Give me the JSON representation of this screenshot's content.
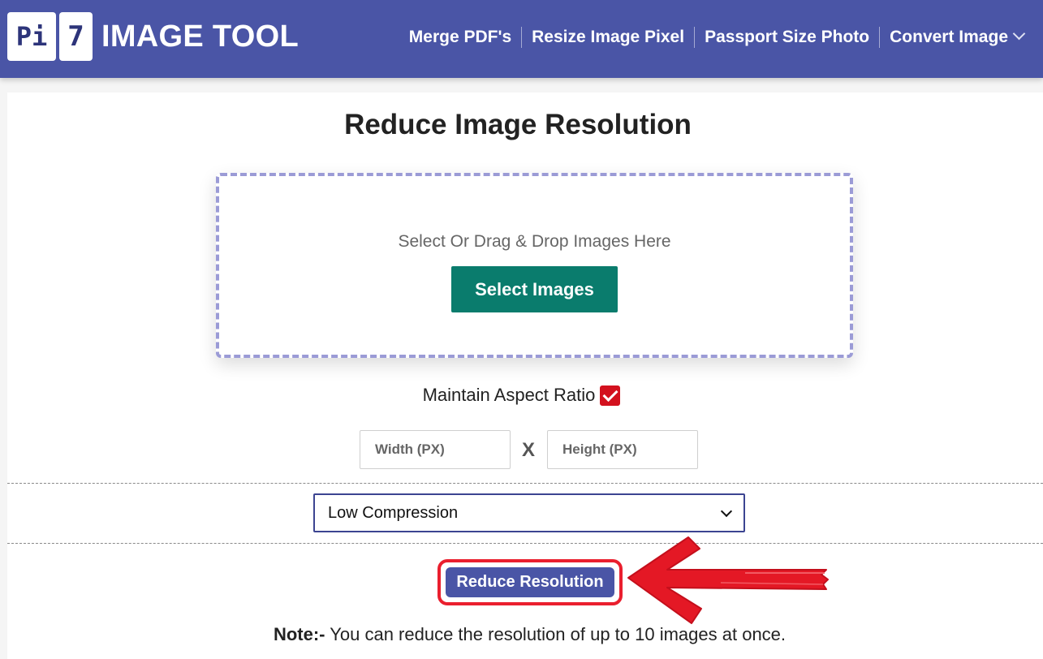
{
  "header": {
    "logo_left": "Pi",
    "logo_right": "7",
    "brand": "IMAGE TOOL",
    "nav": [
      {
        "label": "Merge PDF's"
      },
      {
        "label": "Resize Image Pixel"
      },
      {
        "label": "Passport Size Photo"
      },
      {
        "label": "Convert Image",
        "icon": "chevron-down-icon"
      }
    ],
    "bg_color": "#4a55a6"
  },
  "main": {
    "title": "Reduce Image Resolution",
    "dropzone": {
      "prompt": "Select Or Drag & Drop Images Here",
      "button_label": "Select Images",
      "button_color": "#0a7c6d"
    },
    "aspect": {
      "label": "Maintain Aspect Ratio",
      "checked": true,
      "check_color": "#d3111e"
    },
    "dimensions": {
      "width_placeholder": "Width (PX)",
      "separator": "X",
      "height_placeholder": "Height (PX)"
    },
    "compression": {
      "selected": "Low Compression"
    },
    "action": {
      "button_label": "Reduce Resolution",
      "highlight_color": "#ea1f2e",
      "annotation_icon": "red-arrow-pointer-icon"
    },
    "note": {
      "prefix": "Note:-",
      "text": "You can reduce the resolution of up to 10 images at once."
    }
  }
}
